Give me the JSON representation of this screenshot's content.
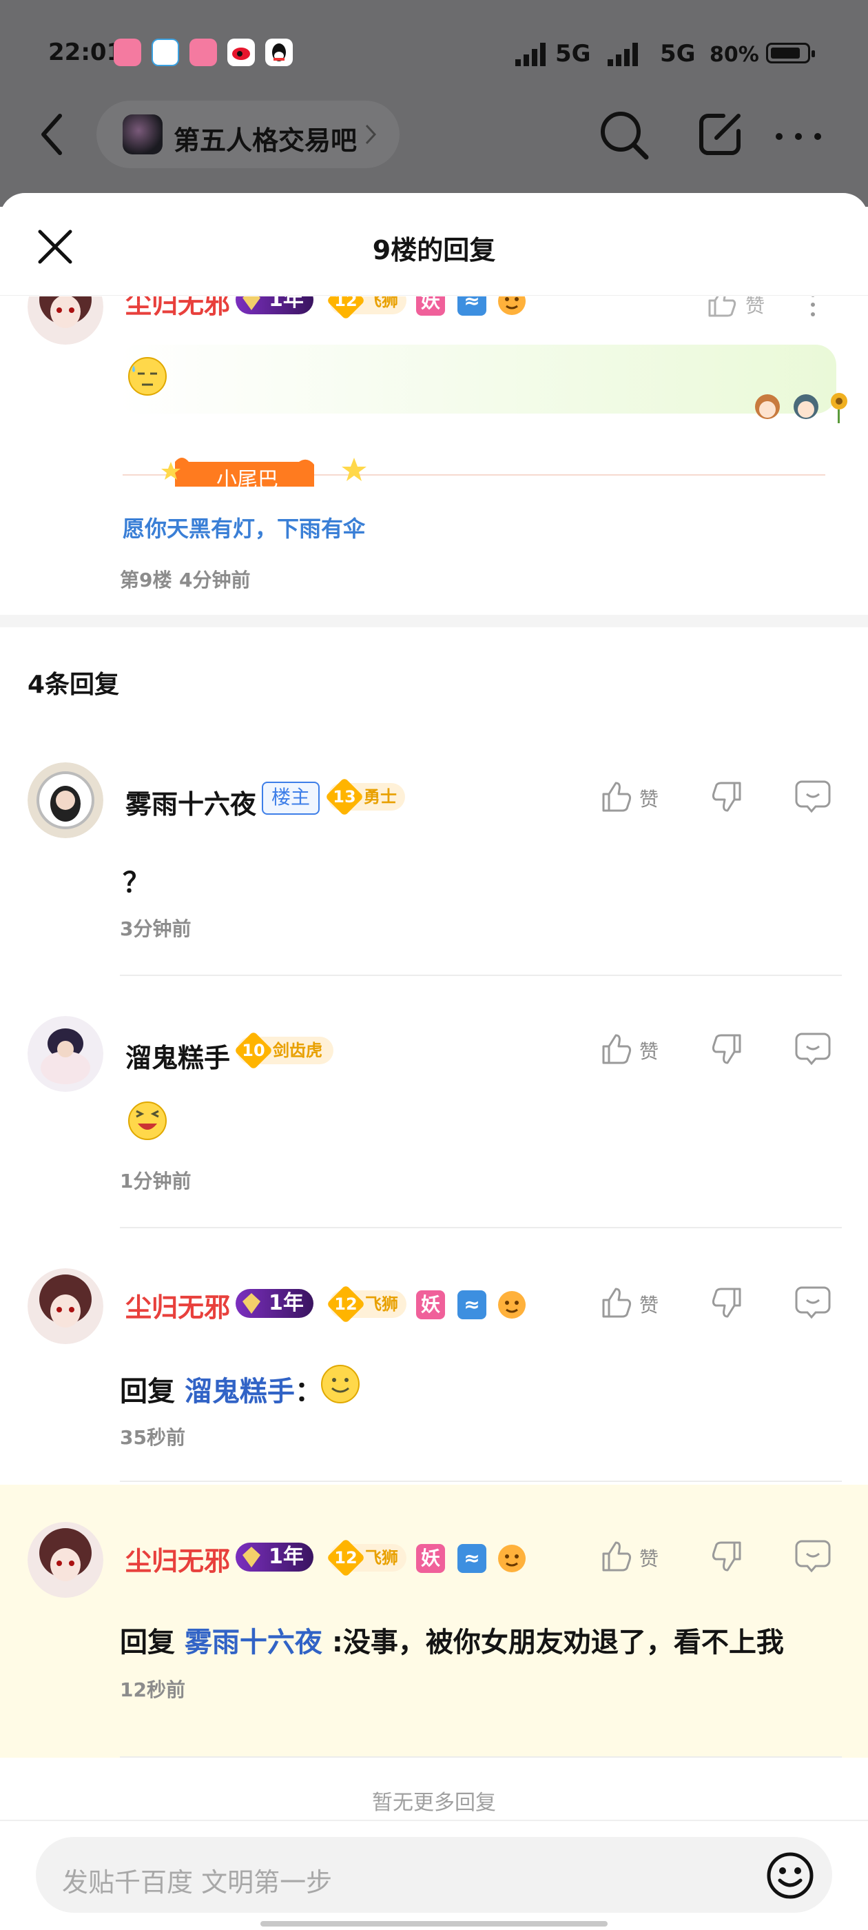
{
  "status_bar": {
    "time": "22:01",
    "network1": "5G",
    "network2": "5G",
    "battery": "80%",
    "battery_level": 0.8
  },
  "app_bar": {
    "forum_name": "第五人格交易吧"
  },
  "sheet": {
    "title": "9楼的回复"
  },
  "main_post": {
    "username": "尘归无邪",
    "year_badge": "1年",
    "level": "12",
    "level_title": "飞狮",
    "badge_yao": "妖",
    "like_label": "赞",
    "tail_label": "小尾巴",
    "signature": "愿你天黑有灯，下雨有伞",
    "floor": "第9楼",
    "time": "4分钟前"
  },
  "replies_header": "4条回复",
  "replies": [
    {
      "username": "雾雨十六夜",
      "role_badge": "楼主",
      "level": "13",
      "level_title": "勇士",
      "content": "？",
      "time": "3分钟前",
      "like_label": "赞"
    },
    {
      "username": "溜鬼糕手",
      "level": "10",
      "level_title": "剑齿虎",
      "time": "1分钟前",
      "like_label": "赞"
    },
    {
      "username": "尘归无邪",
      "year_badge": "1年",
      "level": "12",
      "level_title": "飞狮",
      "badge_yao": "妖",
      "reply_prefix": "回复",
      "reply_to": "溜鬼糕手",
      "reply_sep": "：",
      "time": "35秒前",
      "like_label": "赞"
    },
    {
      "username": "尘归无邪",
      "year_badge": "1年",
      "level": "12",
      "level_title": "飞狮",
      "badge_yao": "妖",
      "reply_prefix": "回复",
      "reply_to": "雾雨十六夜",
      "reply_body": ":没事，被你女朋友劝退了，看不上我",
      "time": "12秒前",
      "like_label": "赞"
    }
  ],
  "footer": {
    "no_more": "暂无更多回复"
  },
  "input": {
    "placeholder": "发贴千百度 文明第一步"
  }
}
